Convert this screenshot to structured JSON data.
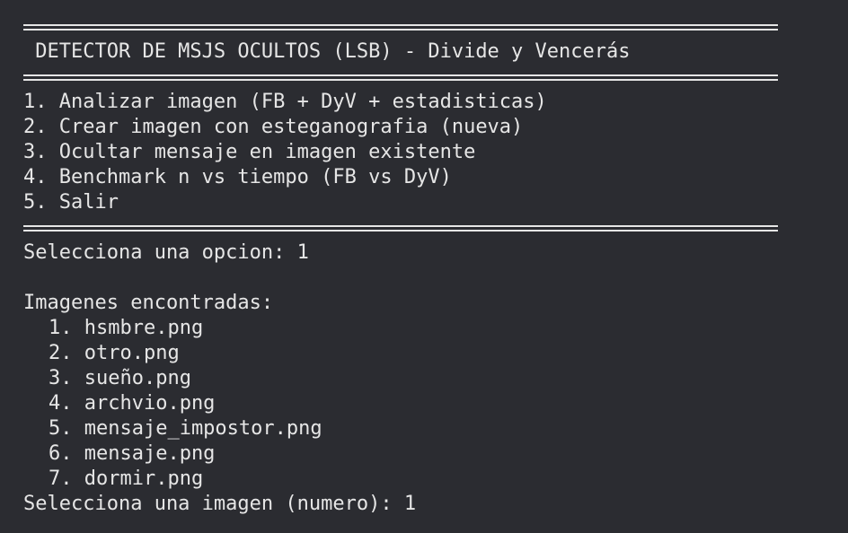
{
  "terminal": {
    "header_title": " DETECTOR DE MSJS OCULTOS (LSB) - Divide y Vencerás",
    "menu": [
      "1. Analizar imagen (FB + DyV + estadisticas)",
      "2. Crear imagen con esteganografia (nueva)",
      "3. Ocultar mensaje en imagen existente",
      "4. Benchmark n vs tiempo (FB vs DyV)",
      "5. Salir"
    ],
    "prompt_option": "Selecciona una opcion: 1",
    "images_heading": "Imagenes encontradas:",
    "images": [
      "1. hsmbre.png",
      "2. otro.png",
      "3. sueño.png",
      "4. archvio.png",
      "5. mensaje_impostor.png",
      "6. mensaje.png",
      "7. dormir.png"
    ],
    "prompt_image": "Selecciona una imagen (numero): 1"
  },
  "colors": {
    "background": "#2b2c31",
    "foreground": "#e6e6e6"
  }
}
